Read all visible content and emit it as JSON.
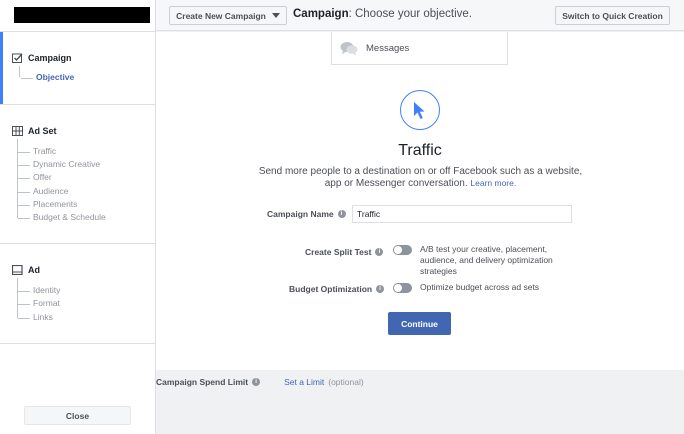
{
  "sidebar": {
    "campaign": {
      "title": "Campaign",
      "items": [
        "Objective"
      ]
    },
    "adset": {
      "title": "Ad Set",
      "items": [
        "Traffic",
        "Dynamic Creative",
        "Offer",
        "Audience",
        "Placements",
        "Budget & Schedule"
      ]
    },
    "ad": {
      "title": "Ad",
      "items": [
        "Identity",
        "Format",
        "Links"
      ]
    },
    "close_label": "Close"
  },
  "header": {
    "create_label": "Create New Campaign",
    "title_bold": "Campaign",
    "title_rest": ": Choose your objective.",
    "quick_label": "Switch to Quick Creation"
  },
  "main": {
    "messages_label": "Messages",
    "objective_title": "Traffic",
    "objective_desc": "Send more people to a destination on or off Facebook such as a website, app or Messenger conversation.",
    "learn_more": "Learn more.",
    "campaign_name_label": "Campaign Name",
    "campaign_name_value": "Traffic",
    "split_test_label": "Create Split Test",
    "split_test_desc": "A/B test your creative, placement, audience, and delivery optimization strategies",
    "budget_label": "Budget Optimization",
    "budget_desc": "Optimize budget across ad sets",
    "continue_label": "Continue"
  },
  "footer": {
    "spend_label": "Campaign Spend Limit",
    "set_limit": "Set a Limit",
    "optional": "(optional)"
  },
  "colors": {
    "accent": "#4267b2",
    "active_bar": "#4080ff"
  }
}
